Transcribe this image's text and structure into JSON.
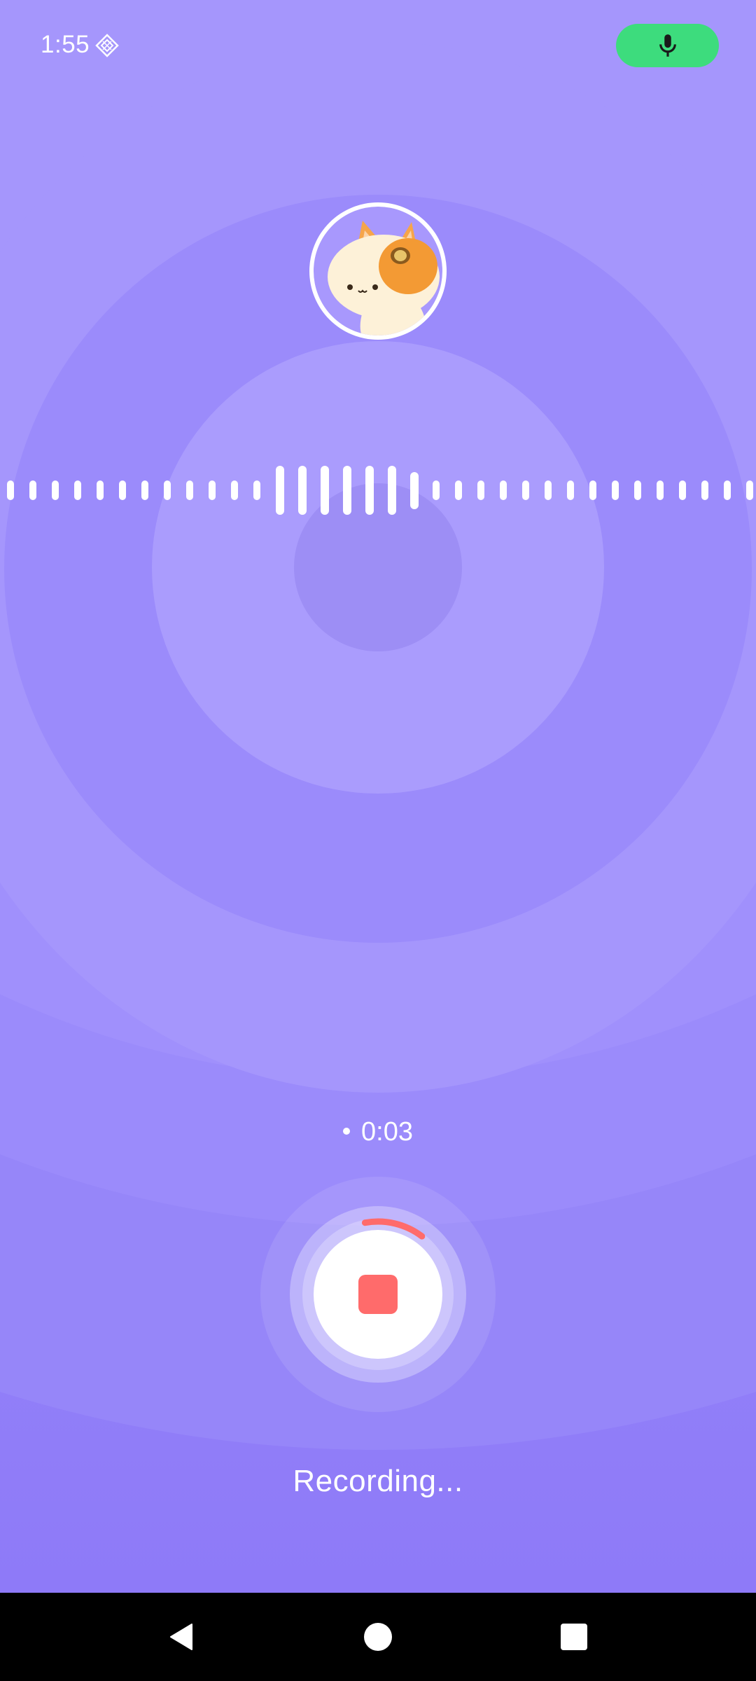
{
  "status_bar": {
    "time": "1:55",
    "indicator_icon": "sparkle-diamond-icon",
    "mic_indicator_icon": "microphone-icon",
    "mic_indicator_color": "#3ddc7d"
  },
  "avatar": {
    "icon": "cat-avatar-icon"
  },
  "waveform": {
    "levels": [
      0.4,
      0.4,
      0.4,
      0.4,
      0.4,
      0.4,
      0.4,
      0.4,
      0.4,
      0.4,
      0.4,
      0.4,
      1.0,
      1.0,
      1.0,
      1.0,
      1.0,
      1.0,
      0.75,
      0.4,
      0.4,
      0.4,
      0.4,
      0.4,
      0.4,
      0.4,
      0.4,
      0.4,
      0.4,
      0.4,
      0.4,
      0.4,
      0.4,
      0.4
    ]
  },
  "recording": {
    "elapsed": "0:03",
    "status_label": "Recording...",
    "progress_fraction": 0.1,
    "stop_color": "#ff6b6b"
  },
  "navigation": {
    "back_icon": "back-triangle-icon",
    "home_icon": "home-circle-icon",
    "recents_icon": "recents-square-icon"
  }
}
